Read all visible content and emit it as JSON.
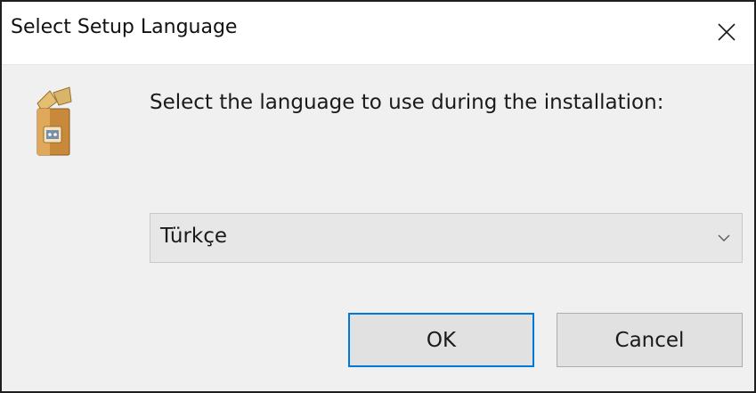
{
  "window": {
    "title": "Select Setup Language",
    "close_icon": "close-icon"
  },
  "content": {
    "icon": "setup-box-icon",
    "prompt": "Select the language to use during the installation:"
  },
  "language_select": {
    "selected": "Türkçe",
    "arrow_icon": "chevron-down-icon"
  },
  "buttons": {
    "ok_label": "OK",
    "cancel_label": "Cancel"
  },
  "colors": {
    "focus_border": "#0078d7",
    "dialog_background": "#f0f0f0",
    "titlebar_background": "#ffffff"
  }
}
